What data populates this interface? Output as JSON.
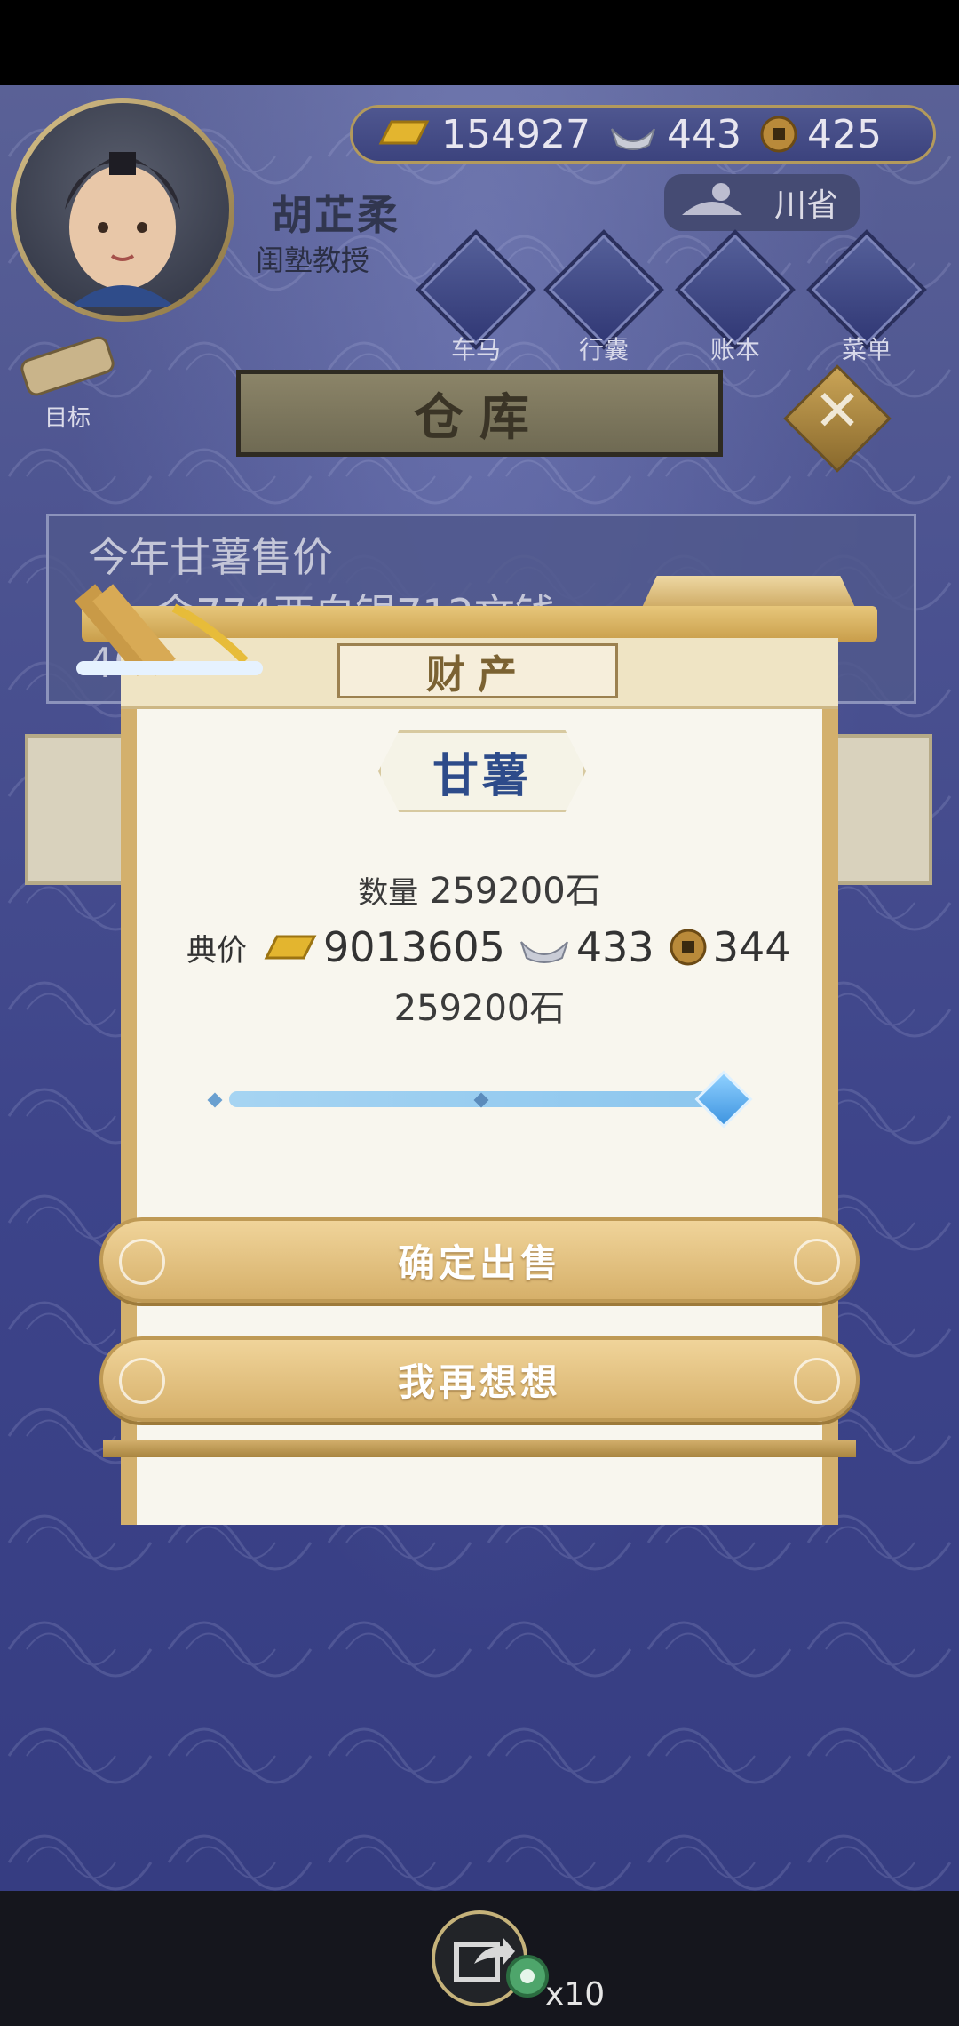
{
  "header": {
    "player_name": "胡芷柔",
    "player_title": "闺塾教授",
    "currency": {
      "gold": "154927",
      "silver": "443",
      "coin": "425"
    },
    "location": "川省",
    "nav": [
      {
        "label": "车马"
      },
      {
        "label": "行囊"
      },
      {
        "label": "账本"
      },
      {
        "label": "菜单"
      }
    ],
    "goal_label": "目标"
  },
  "warehouse": {
    "title": "仓库",
    "price_line1": "今年甘薯售价",
    "price_line2": "3…金774两白银712文钱",
    "price_line3": "40"
  },
  "dialog": {
    "title": "财产",
    "item_name": "甘薯",
    "quantity_label": "数量",
    "quantity_value": "259200石",
    "price_label": "典价",
    "price_gold": "9013605",
    "price_silver": "433",
    "price_coin": "344",
    "selected_amount": "259200石",
    "slider_level": 1.0,
    "confirm_label": "确定出售",
    "cancel_label": "我再想想"
  },
  "footer": {
    "share_count": "x10"
  },
  "colors": {
    "background": "#4a5190",
    "gold_button": "#d6b06a",
    "item_name": "#2d4b8a",
    "slider": "#8cc6ee"
  }
}
